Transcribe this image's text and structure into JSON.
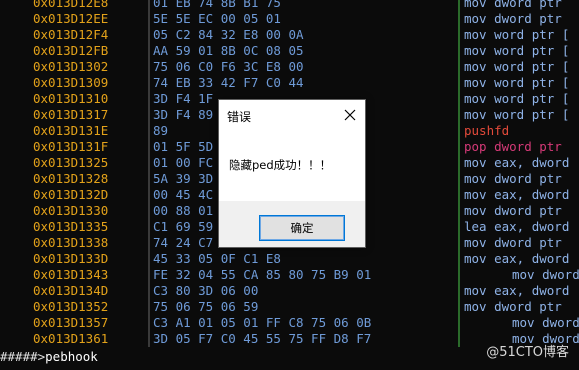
{
  "addresses": [
    "0x013D12E8",
    "0x013D12EE",
    "0x013D12F4",
    "0x013D12FB",
    "0x013D1302",
    "0x013D1309",
    "0x013D1310",
    "0x013D1317",
    "0x013D131E",
    "0x013D131F",
    "0x013D1325",
    "0x013D1328",
    "0x013D132D",
    "0x013D1330",
    "0x013D1335",
    "0x013D1338",
    "0x013D133D",
    "0x013D1343",
    "0x013D134D",
    "0x013D1352",
    "0x013D1357",
    "0x013D1361"
  ],
  "bytes": [
    "01 EB 74 8B B1 75",
    "5E 5E EC 00 05 01",
    "05 C2 84 32 E8 00 0A",
    "AA 59 01 8B 0C 08 05",
    "75 06 C0 F6 3C E8 00",
    "74 EB 33 42 F7 C0 44",
    "3D F4 1F",
    "3D F4 89",
    "89",
    "01 5F 5D",
    "01 00 FC",
    "5A 39 3D",
    "00 45 4C",
    "00 88 01",
    "C1 69 59",
    "74 24 C7",
    "45 33 05 0F C1 E8",
    "FE 32 04 55 CA 85 80 75 B9 01",
    "C3 80 3D 06 00",
    "75 06 75 06 59",
    "C3 A1 01 05 01 FF C8 75 06 0B",
    "3D 05 F7 C0 45 55 75 FF D8 F7"
  ],
  "disasm": [
    "mov dword ptr",
    "mov dword ptr",
    "mov word ptr [",
    "mov word ptr [",
    "mov word ptr [",
    "mov word ptr [",
    "mov word ptr [",
    "mov word ptr [",
    "pushfd",
    "pop dword ptr",
    "mov eax, dword",
    "mov dword ptr",
    "mov eax, dword",
    "mov dword ptr",
    "lea eax, dword",
    "mov dword ptr",
    "mov eax, dword",
    "mov dword",
    "mov eax, dword",
    "mov dword ptr",
    "mov dword",
    "mov dword"
  ],
  "prompt": {
    "hashes": "#####>",
    "command": "pebhook"
  },
  "dialog": {
    "title": "错误",
    "message": "隐藏ped成功！！！",
    "ok_label": "确定"
  },
  "watermark": "@51CTO博客",
  "colors": {
    "address": "#e3a21a",
    "bytes": "#6f9bd8",
    "disasm": "#8fb3e8",
    "pushfd": "#e34a3a"
  }
}
